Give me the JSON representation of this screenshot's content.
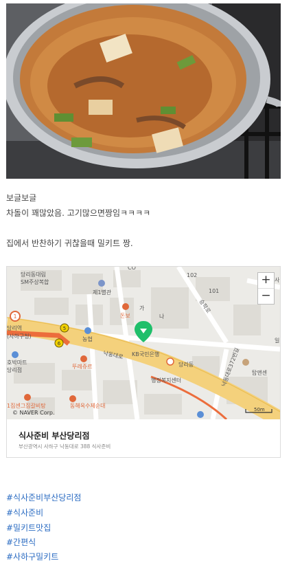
{
  "post": {
    "line1": "보글보글",
    "line2": "차돌이 꽤많았음. 고기많으면짱임ㅋㅋㅋㅋ",
    "line3": "집에서 반찬하기 귀찮을때 밀키트 짱."
  },
  "map": {
    "zoom_in": "+",
    "zoom_out": "−",
    "copyright": "© NAVER Corp.",
    "scale": "50m",
    "labels": {
      "l1": "당리동대림",
      "l2": "SM주상복합",
      "l3": "제1별관",
      "l4": "돈보",
      "l5": "당리역",
      "l6": "(사하구청)",
      "l7": "농협",
      "l8": "호박마트",
      "l9": "당리점",
      "l10": "뚜레쥬르",
      "l11": "낙동대로",
      "l12": "KB국민은행",
      "l13": "당리동",
      "l14": "행정복지센터",
      "l15": "낙동대로372번길",
      "l16": "탑앤센",
      "l17": "동해옥수제순대",
      "l18": "1집센그집갈비탕",
      "l19": "승학로",
      "l20": "가",
      "l21": "나",
      "l22": "102",
      "l23": "101",
      "l24": "사",
      "l25": "일",
      "l26": "CO"
    },
    "station_badges": [
      "1",
      "5",
      "6"
    ]
  },
  "place": {
    "name": "식사준비 부산당리점",
    "address": "부산광역시 사하구 낙동대로 388 식사준비"
  },
  "tags": [
    "#식사준비부산당리점",
    "#식사준비",
    "#밀키트맛집",
    "#간편식",
    "#사하구밀키트"
  ]
}
